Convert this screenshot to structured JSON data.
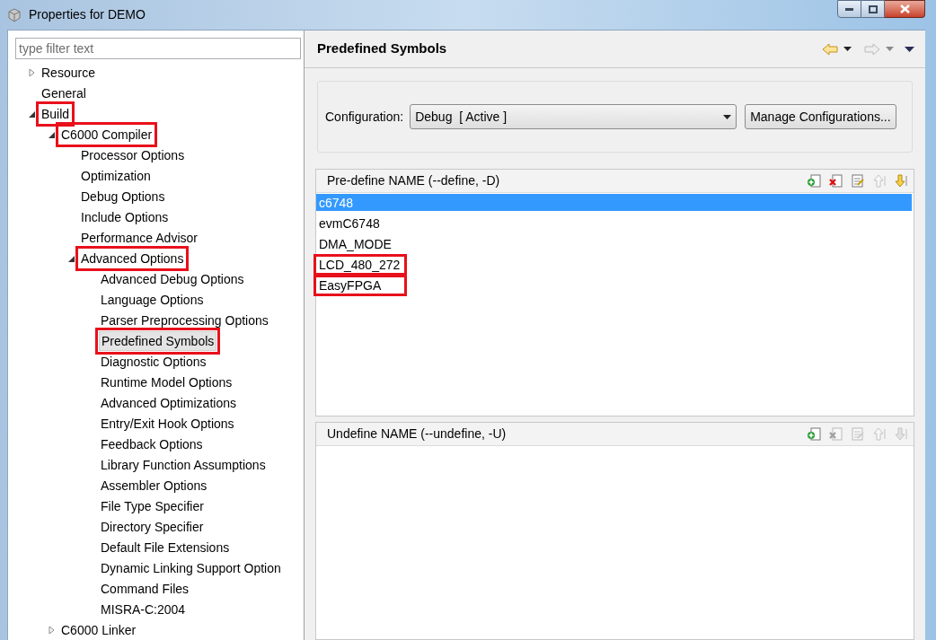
{
  "window": {
    "title": "Properties for DEMO"
  },
  "filter": {
    "placeholder": "type filter text"
  },
  "tree": [
    {
      "label": "Resource",
      "expanded": false,
      "selected": false,
      "highlighted": false
    },
    {
      "label": "General",
      "selected": false,
      "highlighted": false
    },
    {
      "label": "Build",
      "expanded": true,
      "selected": false,
      "highlighted": true,
      "children": [
        {
          "label": "C6000 Compiler",
          "expanded": true,
          "selected": false,
          "highlighted": true,
          "children": [
            {
              "label": "Processor Options",
              "selected": false,
              "highlighted": false
            },
            {
              "label": "Optimization",
              "selected": false,
              "highlighted": false
            },
            {
              "label": "Debug Options",
              "selected": false,
              "highlighted": false
            },
            {
              "label": "Include Options",
              "selected": false,
              "highlighted": false
            },
            {
              "label": "Performance Advisor",
              "selected": false,
              "highlighted": false
            },
            {
              "label": "Advanced Options",
              "expanded": true,
              "selected": false,
              "highlighted": true,
              "children": [
                {
                  "label": "Advanced Debug Options",
                  "selected": false,
                  "highlighted": false
                },
                {
                  "label": "Language Options",
                  "selected": false,
                  "highlighted": false
                },
                {
                  "label": "Parser Preprocessing Options",
                  "selected": false,
                  "highlighted": false
                },
                {
                  "label": "Predefined Symbols",
                  "selected": true,
                  "highlighted": true
                },
                {
                  "label": "Diagnostic Options",
                  "selected": false,
                  "highlighted": false
                },
                {
                  "label": "Runtime Model Options",
                  "selected": false,
                  "highlighted": false
                },
                {
                  "label": "Advanced Optimizations",
                  "selected": false,
                  "highlighted": false
                },
                {
                  "label": "Entry/Exit Hook Options",
                  "selected": false,
                  "highlighted": false
                },
                {
                  "label": "Feedback Options",
                  "selected": false,
                  "highlighted": false
                },
                {
                  "label": "Library Function Assumptions",
                  "selected": false,
                  "highlighted": false
                },
                {
                  "label": "Assembler Options",
                  "selected": false,
                  "highlighted": false
                },
                {
                  "label": "File Type Specifier",
                  "selected": false,
                  "highlighted": false
                },
                {
                  "label": "Directory Specifier",
                  "selected": false,
                  "highlighted": false
                },
                {
                  "label": "Default File Extensions",
                  "selected": false,
                  "highlighted": false
                },
                {
                  "label": "Dynamic Linking Support Option",
                  "selected": false,
                  "highlighted": false
                },
                {
                  "label": "Command Files",
                  "selected": false,
                  "highlighted": false
                },
                {
                  "label": "MISRA-C:2004",
                  "selected": false,
                  "highlighted": false
                }
              ]
            }
          ]
        },
        {
          "label": "C6000 Linker",
          "expanded": false,
          "selected": false,
          "highlighted": false
        }
      ]
    }
  ],
  "page": {
    "title": "Predefined Symbols"
  },
  "configuration": {
    "label": "Configuration:",
    "value": "Debug  [ Active ]",
    "button": "Manage Configurations..."
  },
  "lists": [
    {
      "title": "Pre-define NAME (--define, -D)",
      "tools": [
        {
          "kind": "add",
          "disabled": false
        },
        {
          "kind": "delete",
          "disabled": false
        },
        {
          "kind": "edit",
          "disabled": false
        },
        {
          "kind": "up",
          "disabled": true
        },
        {
          "kind": "down",
          "disabled": false
        }
      ],
      "items": [
        {
          "label": "c6748",
          "selected": true,
          "highlighted": false
        },
        {
          "label": "evmC6748",
          "selected": false,
          "highlighted": false
        },
        {
          "label": "DMA_MODE",
          "selected": false,
          "highlighted": false
        },
        {
          "label": "LCD_480_272",
          "selected": false,
          "highlighted": true
        },
        {
          "label": "EasyFPGA",
          "selected": false,
          "highlighted": true
        }
      ]
    },
    {
      "title": "Undefine NAME (--undefine, -U)",
      "tools": [
        {
          "kind": "add",
          "disabled": false
        },
        {
          "kind": "delete",
          "disabled": true
        },
        {
          "kind": "edit",
          "disabled": true
        },
        {
          "kind": "up",
          "disabled": true
        },
        {
          "kind": "down",
          "disabled": true
        }
      ]
    }
  ]
}
